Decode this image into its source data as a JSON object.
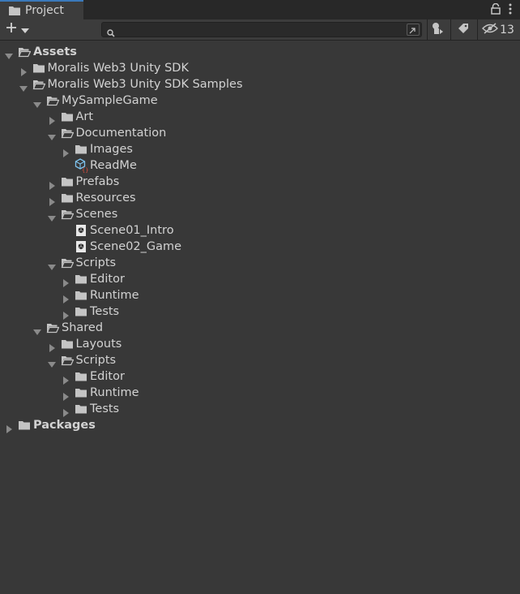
{
  "tab": {
    "title": "Project"
  },
  "toolbar": {
    "search_placeholder": "",
    "search_value": "",
    "hidden_count": "13"
  },
  "tree": [
    {
      "label": "Assets",
      "depth": 0,
      "expanded": true,
      "bold": true,
      "icon": "folder-open-icon",
      "arrow": true
    },
    {
      "label": "Moralis Web3 Unity SDK",
      "depth": 1,
      "expanded": false,
      "icon": "folder-icon",
      "arrow": true
    },
    {
      "label": "Moralis Web3 Unity SDK Samples",
      "depth": 1,
      "expanded": true,
      "icon": "folder-open-icon",
      "arrow": true
    },
    {
      "label": "MySampleGame",
      "depth": 2,
      "expanded": true,
      "icon": "folder-open-icon",
      "arrow": true
    },
    {
      "label": "Art",
      "depth": 3,
      "expanded": false,
      "icon": "folder-icon",
      "arrow": true
    },
    {
      "label": "Documentation",
      "depth": 3,
      "expanded": true,
      "icon": "folder-open-icon",
      "arrow": true
    },
    {
      "label": "Images",
      "depth": 4,
      "expanded": false,
      "icon": "folder-icon",
      "arrow": true
    },
    {
      "label": "ReadMe",
      "depth": 4,
      "icon": "scriptable-object-icon",
      "arrow": false
    },
    {
      "label": "Prefabs",
      "depth": 3,
      "expanded": false,
      "icon": "folder-icon",
      "arrow": true
    },
    {
      "label": "Resources",
      "depth": 3,
      "expanded": false,
      "icon": "folder-icon",
      "arrow": true
    },
    {
      "label": "Scenes",
      "depth": 3,
      "expanded": true,
      "icon": "folder-open-icon",
      "arrow": true
    },
    {
      "label": "Scene01_Intro",
      "depth": 4,
      "icon": "scene-icon",
      "arrow": false
    },
    {
      "label": "Scene02_Game",
      "depth": 4,
      "icon": "scene-icon",
      "arrow": false
    },
    {
      "label": "Scripts",
      "depth": 3,
      "expanded": true,
      "icon": "folder-open-icon",
      "arrow": true
    },
    {
      "label": "Editor",
      "depth": 4,
      "expanded": false,
      "icon": "folder-icon",
      "arrow": true
    },
    {
      "label": "Runtime",
      "depth": 4,
      "expanded": false,
      "icon": "folder-icon",
      "arrow": true
    },
    {
      "label": "Tests",
      "depth": 4,
      "expanded": false,
      "icon": "folder-icon",
      "arrow": true
    },
    {
      "label": "Shared",
      "depth": 2,
      "expanded": true,
      "icon": "folder-open-icon",
      "arrow": true
    },
    {
      "label": "Layouts",
      "depth": 3,
      "expanded": false,
      "icon": "folder-icon",
      "arrow": true
    },
    {
      "label": "Scripts",
      "depth": 3,
      "expanded": true,
      "icon": "folder-open-icon",
      "arrow": true
    },
    {
      "label": "Editor",
      "depth": 4,
      "expanded": false,
      "icon": "folder-icon",
      "arrow": true
    },
    {
      "label": "Runtime",
      "depth": 4,
      "expanded": false,
      "icon": "folder-icon",
      "arrow": true
    },
    {
      "label": "Tests",
      "depth": 4,
      "expanded": false,
      "icon": "folder-icon",
      "arrow": true
    },
    {
      "label": "Packages",
      "depth": 0,
      "expanded": false,
      "bold": true,
      "icon": "folder-icon",
      "arrow": true
    }
  ],
  "colors": {
    "panel_bg": "#383838",
    "toolbar_bg": "#3c3c3c",
    "tab_accent": "#3a79bb",
    "text": "#d2d2d2",
    "icon": "#c4c4c4",
    "arrow": "#8a8a8a"
  }
}
